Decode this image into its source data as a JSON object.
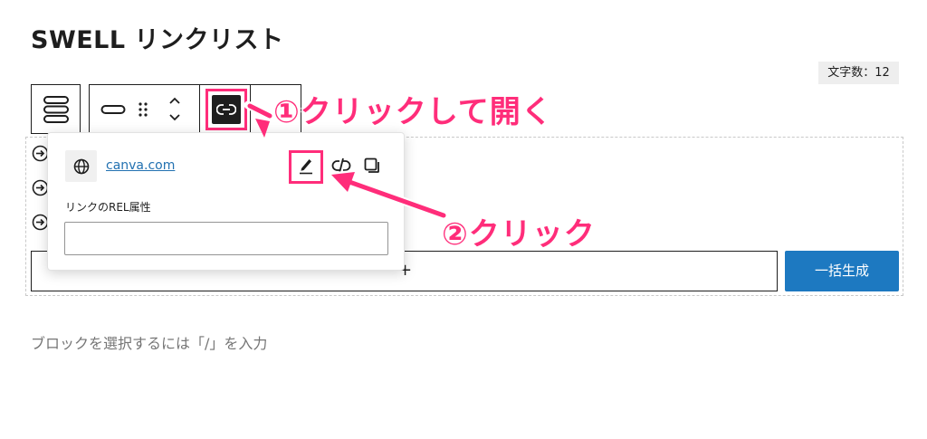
{
  "page": {
    "title": "SWELL リンクリスト",
    "char_count": "文字数：12",
    "placeholder": "ブロックを選択するには「/」を入力"
  },
  "toolbar": {
    "icons": [
      "list-block-icon",
      "button-style-icon",
      "drag-handle-icon",
      "move-up-icon",
      "move-down-icon",
      "link-icon"
    ]
  },
  "block": {
    "list_icons": [
      "arrow-circle-icon",
      "arrow-circle-icon",
      "arrow-circle-icon"
    ],
    "appender_symbol": "+",
    "generate_button": "一括生成"
  },
  "popover": {
    "url_text": "canva.com",
    "rel_label": "リンクのREL属性",
    "rel_value": ""
  },
  "annotations": {
    "step1": "①クリックして開く",
    "step2": "②クリック",
    "color": "#ff2d7a"
  },
  "colors": {
    "primary_button": "#1d79c1",
    "link": "#2271b1",
    "highlight": "#ff2d7a"
  }
}
